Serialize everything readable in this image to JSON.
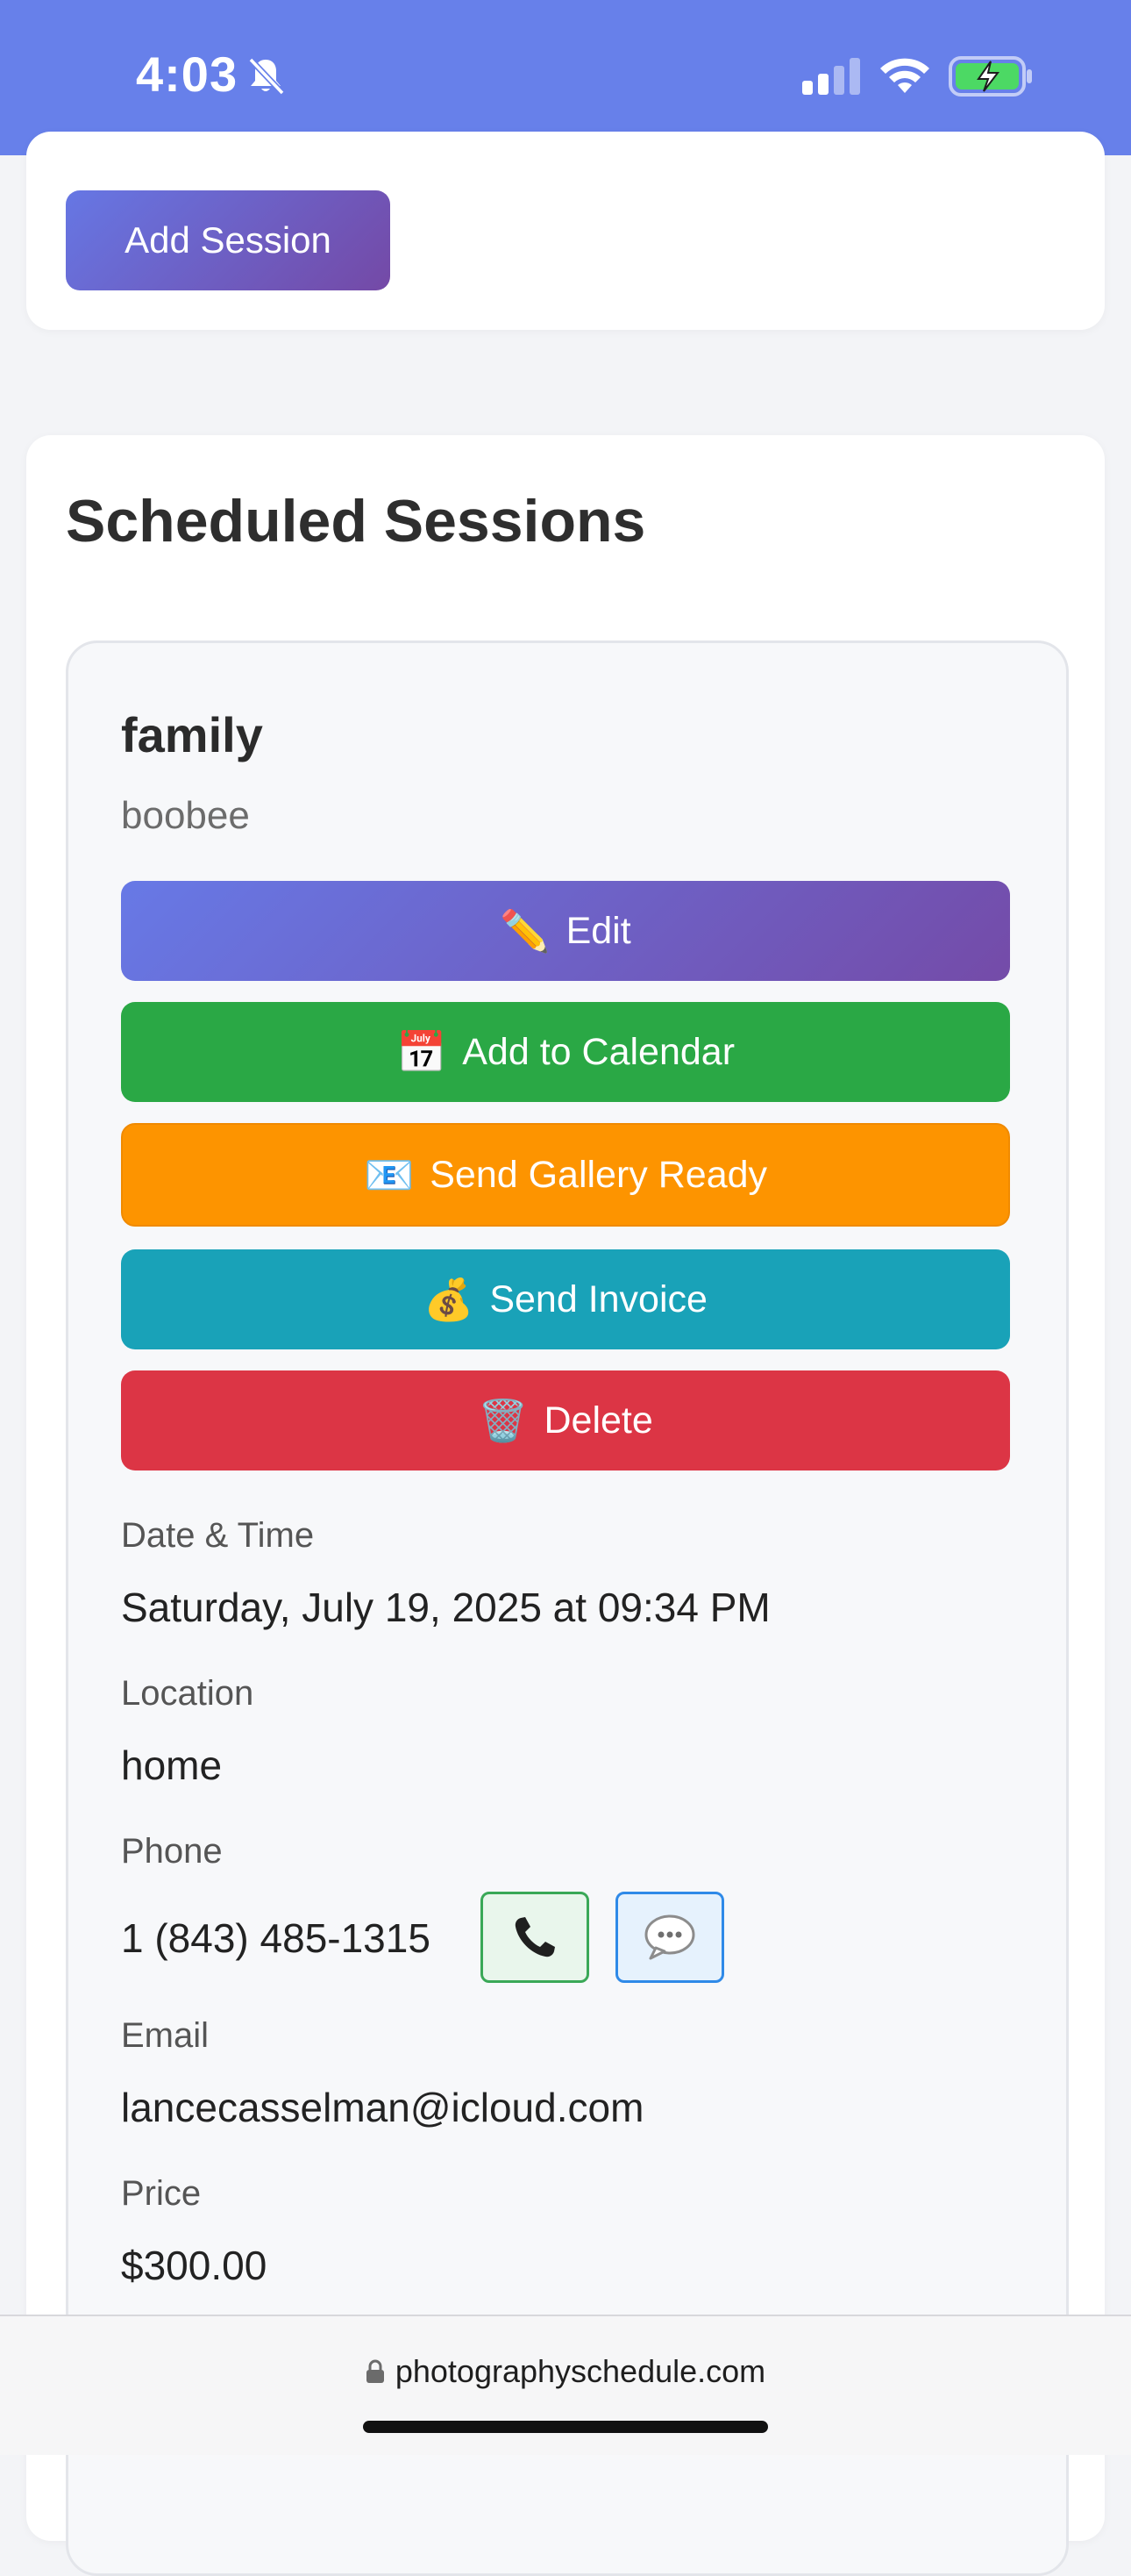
{
  "status_bar": {
    "time": "4:03",
    "background_color": "#6780ea",
    "icons": [
      "bell-slash-icon",
      "signal-icon",
      "wifi-icon",
      "battery-charging-icon"
    ]
  },
  "top_card": {
    "add_session_label": "Add Session"
  },
  "sessions": {
    "title": "Scheduled Sessions",
    "items": [
      {
        "type": "family",
        "client": "boobee",
        "actions": {
          "edit": {
            "icon": "✏️",
            "label": "Edit",
            "color": "#6f62c7"
          },
          "calendar": {
            "icon": "📅",
            "label": "Add to Calendar",
            "color": "#2aa845"
          },
          "gallery": {
            "icon": "📧",
            "label": "Send Gallery Ready",
            "color": "#fd9400"
          },
          "invoice": {
            "icon": "💰",
            "label": "Send Invoice",
            "color": "#19a2b8"
          },
          "delete": {
            "icon": "🗑️",
            "label": "Delete",
            "color": "#dc3545"
          }
        },
        "fields": {
          "datetime_label": "Date & Time",
          "datetime_value": "Saturday, July 19, 2025 at 09:34 PM",
          "location_label": "Location",
          "location_value": "home",
          "phone_label": "Phone",
          "phone_value": "1 (843) 485-1315",
          "email_label": "Email",
          "email_value": "lancecasselman@icloud.com",
          "price_label": "Price",
          "price_value": "$300.00"
        },
        "phone_actions": [
          "phone-icon",
          "message-bubble-icon"
        ]
      }
    ]
  },
  "browser": {
    "url": "photographyschedule.com"
  }
}
